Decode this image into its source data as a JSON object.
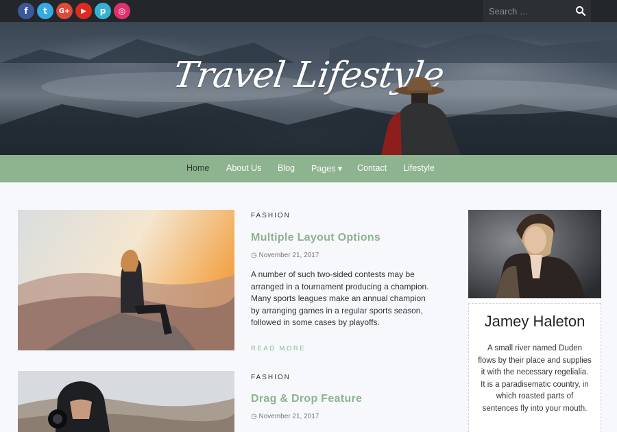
{
  "colors": {
    "accent": "#8db38f",
    "topbar": "#23272b",
    "background": "#f6f8fc"
  },
  "social": [
    {
      "icon": "facebook-icon",
      "glyph": "f",
      "color": "#3b5998"
    },
    {
      "icon": "twitter-icon",
      "glyph": "t",
      "color": "#35a9e0"
    },
    {
      "icon": "google-plus-icon",
      "glyph": "G+",
      "color": "#dd4b39"
    },
    {
      "icon": "youtube-icon",
      "glyph": "▶",
      "color": "#e02a20"
    },
    {
      "icon": "pinterest-icon",
      "glyph": "p",
      "color": "#36b1d4"
    },
    {
      "icon": "instagram-icon",
      "glyph": "◎",
      "color": "#e1306c"
    }
  ],
  "search": {
    "placeholder": "Search …"
  },
  "site": {
    "title": "Travel Lifestyle"
  },
  "nav": {
    "items": [
      {
        "label": "Home"
      },
      {
        "label": "About Us"
      },
      {
        "label": "Blog"
      },
      {
        "label": "Pages ▾"
      },
      {
        "label": "Contact"
      },
      {
        "label": "Lifestyle"
      }
    ]
  },
  "posts": [
    {
      "category": "FASHION",
      "title": "Multiple Layout Options",
      "date": "◷ November 21, 2017",
      "excerpt": "A number of such two-sided contests may be arranged in a tournament producing a champion. Many sports leagues make an annual champion by arranging games in a regular sports season, followed in some cases by playoffs.",
      "read_more": "READ MORE"
    },
    {
      "category": "FASHION",
      "title": "Drag & Drop Feature",
      "date": "◷ November 21, 2017"
    }
  ],
  "author": {
    "name": "Jamey Haleton",
    "bio": "A small river named Duden flows by their place and supplies it with the necessary regelialia. It is a paradisematic country, in which roasted parts of sentences fly into your mouth."
  }
}
